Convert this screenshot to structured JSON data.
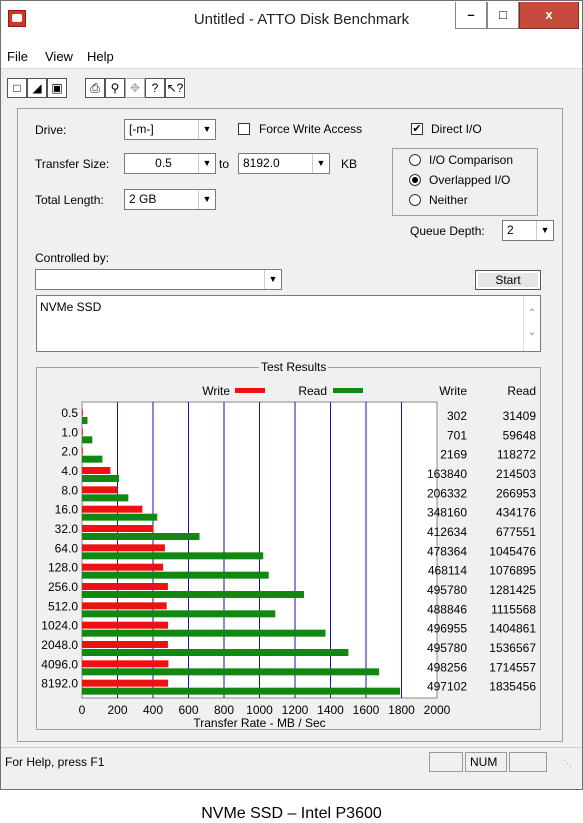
{
  "window": {
    "title": "Untitled - ATTO Disk Benchmark"
  },
  "menu": [
    "File",
    "View",
    "Help"
  ],
  "toolbar": [
    "new-icon",
    "open-icon",
    "save-icon",
    "print-icon",
    "print-preview-icon",
    "move-icon",
    "help-icon",
    "context-help-icon"
  ],
  "form": {
    "drive_label": "Drive:",
    "drive_value": "[-m-]",
    "force_write_label": "Force Write Access",
    "force_write_checked": false,
    "direct_io_label": "Direct I/O",
    "direct_io_checked": true,
    "transfer_size_label": "Transfer Size:",
    "transfer_from": "0.5",
    "to_label": "to",
    "transfer_to": "8192.0",
    "kb_label": "KB",
    "total_length_label": "Total Length:",
    "total_length_value": "2 GB",
    "io_comparison_label": "I/O Comparison",
    "overlapped_io_label": "Overlapped I/O",
    "neither_label": "Neither",
    "io_mode": "Overlapped I/O",
    "queue_depth_label": "Queue Depth:",
    "queue_depth_value": "2",
    "controlled_by_label": "Controlled by:",
    "controlled_by_value": "",
    "start_label": "Start",
    "description": "NVMe SSD"
  },
  "results": {
    "title": "Test Results",
    "write_legend": "Write",
    "read_legend": "Read",
    "write_header": "Write",
    "read_header": "Read",
    "write_color": "#ee1111",
    "read_color": "#118811"
  },
  "status": {
    "help_text": "For Help, press F1",
    "num": "NUM"
  },
  "caption": "NVMe SSD – Intel P3600",
  "chart_data": {
    "type": "bar",
    "orientation": "horizontal",
    "categories": [
      "0.5",
      "1.0",
      "2.0",
      "4.0",
      "8.0",
      "16.0",
      "32.0",
      "64.0",
      "128.0",
      "256.0",
      "512.0",
      "1024.0",
      "2048.0",
      "4096.0",
      "8192.0"
    ],
    "series": [
      {
        "name": "Write",
        "values": [
          302,
          701,
          2169,
          163840,
          206332,
          348160,
          412634,
          478364,
          468114,
          495780,
          488846,
          496955,
          495780,
          498256,
          497102
        ]
      },
      {
        "name": "Read",
        "values": [
          31409,
          59648,
          118272,
          214503,
          266953,
          434176,
          677551,
          1045476,
          1076895,
          1281425,
          1115568,
          1404861,
          1536567,
          1714557,
          1835456
        ]
      }
    ],
    "bar_rates_mb": {
      "write": [
        0.3,
        0.7,
        2.1,
        160,
        201,
        340,
        403,
        467,
        457,
        484,
        477,
        485,
        484,
        487,
        485
      ],
      "read": [
        30.7,
        58,
        115,
        209,
        261,
        424,
        662,
        1021,
        1052,
        1251,
        1089,
        1372,
        1501,
        1674,
        1792
      ]
    },
    "xlabel": "Transfer Rate - MB / Sec",
    "xticks": [
      0,
      200,
      400,
      600,
      800,
      1000,
      1200,
      1400,
      1600,
      1800,
      2000
    ],
    "xlim": [
      0,
      2000
    ],
    "grid": true,
    "legend": "top-center"
  }
}
